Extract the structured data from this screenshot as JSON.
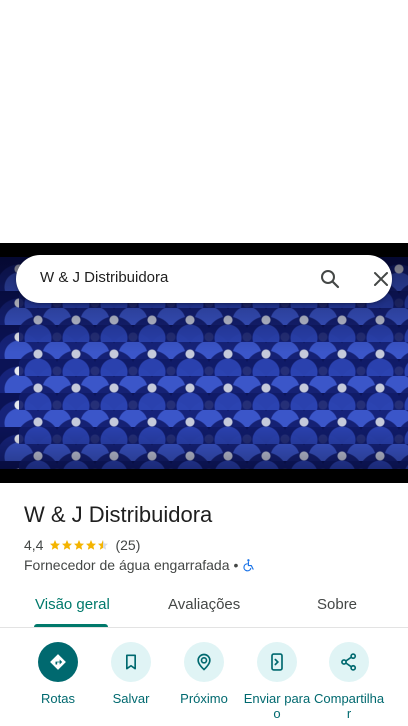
{
  "search": {
    "query": "W & J Distribuidora"
  },
  "place": {
    "name": "W & J Distribuidora",
    "rating": "4,4",
    "stars": 4.5,
    "review_count": "(25)",
    "category": "Fornecedor de água engarrafada",
    "separator": "•"
  },
  "tabs": [
    {
      "label": "Visão geral",
      "active": true
    },
    {
      "label": "Avaliações",
      "active": false
    },
    {
      "label": "Sobre",
      "active": false
    }
  ],
  "actions": [
    {
      "label": "Rotas",
      "icon": "directions-icon"
    },
    {
      "label": "Salvar",
      "icon": "bookmark-icon"
    },
    {
      "label": "Próximo",
      "icon": "nearby-icon"
    },
    {
      "label": "Enviar para o",
      "icon": "send-to-phone-icon"
    },
    {
      "label": "Compartilha r",
      "icon": "share-icon"
    }
  ],
  "colors": {
    "accent": "#00696f",
    "tab_active": "#00796b",
    "star": "#f4b400",
    "action_bg": "#e0f4f5"
  }
}
